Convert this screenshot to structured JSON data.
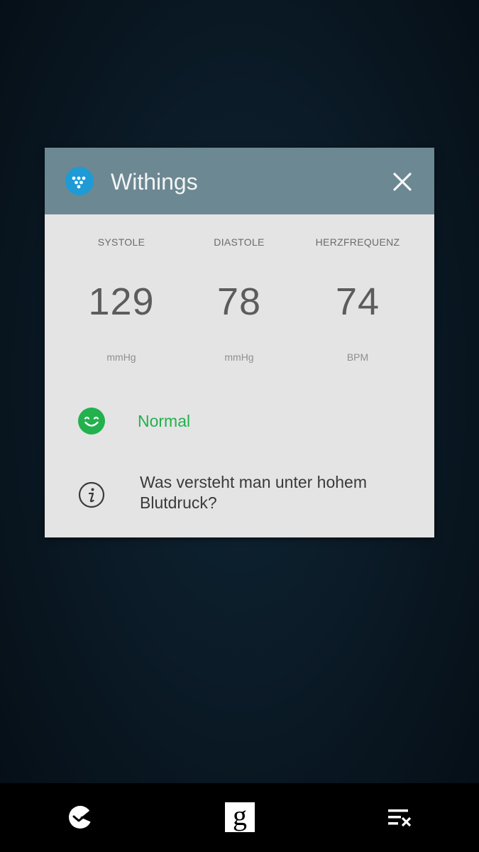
{
  "notification": {
    "app_name": "Withings",
    "app_icon": "withings-logo-icon",
    "close_icon": "close-icon",
    "metrics": [
      {
        "label": "SYSTOLE",
        "value": "129",
        "unit": "mmHg"
      },
      {
        "label": "DIASTOLE",
        "value": "78",
        "unit": "mmHg"
      },
      {
        "label": "HERZFREQUENZ",
        "value": "74",
        "unit": "BPM"
      }
    ],
    "status": {
      "icon": "smiley-icon",
      "text": "Normal",
      "color": "#22b14c"
    },
    "info": {
      "icon": "info-icon",
      "text": "Was versteht man unter hohem Blutdruck?"
    }
  },
  "navbar": {
    "left_icon": "watch-face-icon",
    "center_icon": "google-icon",
    "center_glyph": "g",
    "right_icon": "clear-all-icon"
  },
  "colors": {
    "header": "#6c8892",
    "card": "#e4e4e4",
    "accent_icon": "#1e9ad6"
  }
}
